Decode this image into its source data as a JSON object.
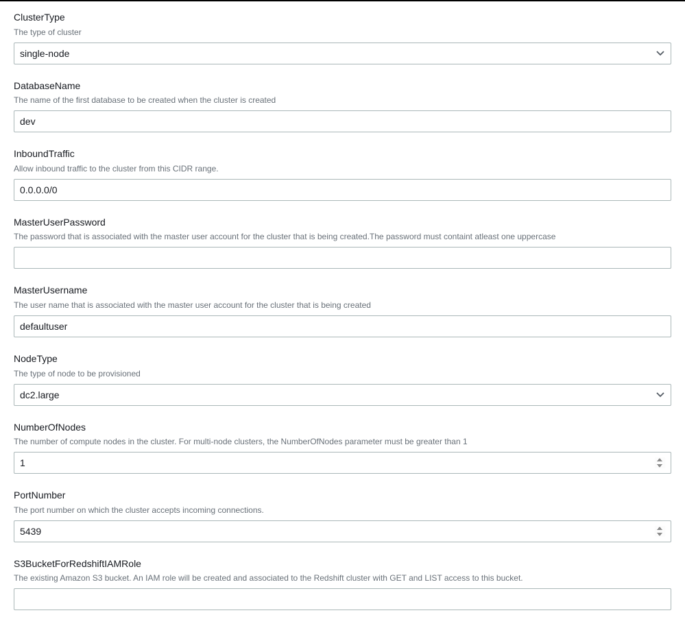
{
  "fields": {
    "clusterType": {
      "label": "ClusterType",
      "desc": "The type of cluster",
      "value": "single-node"
    },
    "databaseName": {
      "label": "DatabaseName",
      "desc": "The name of the first database to be created when the cluster is created",
      "value": "dev"
    },
    "inboundTraffic": {
      "label": "InboundTraffic",
      "desc": "Allow inbound traffic to the cluster from this CIDR range.",
      "value": "0.0.0.0/0"
    },
    "masterUserPassword": {
      "label": "MasterUserPassword",
      "desc": "The password that is associated with the master user account for the cluster that is being created.The password must containt atleast one uppercase",
      "value": ""
    },
    "masterUsername": {
      "label": "MasterUsername",
      "desc": "The user name that is associated with the master user account for the cluster that is being created",
      "value": "defaultuser"
    },
    "nodeType": {
      "label": "NodeType",
      "desc": "The type of node to be provisioned",
      "value": "dc2.large"
    },
    "numberOfNodes": {
      "label": "NumberOfNodes",
      "desc": "The number of compute nodes in the cluster. For multi-node clusters, the NumberOfNodes parameter must be greater than 1",
      "value": "1"
    },
    "portNumber": {
      "label": "PortNumber",
      "desc": "The port number on which the cluster accepts incoming connections.",
      "value": "5439"
    },
    "s3Bucket": {
      "label": "S3BucketForRedshiftIAMRole",
      "desc": "The existing Amazon S3 bucket. An IAM role will be created and associated to the Redshift cluster with GET and LIST access to this bucket.",
      "value": ""
    }
  }
}
